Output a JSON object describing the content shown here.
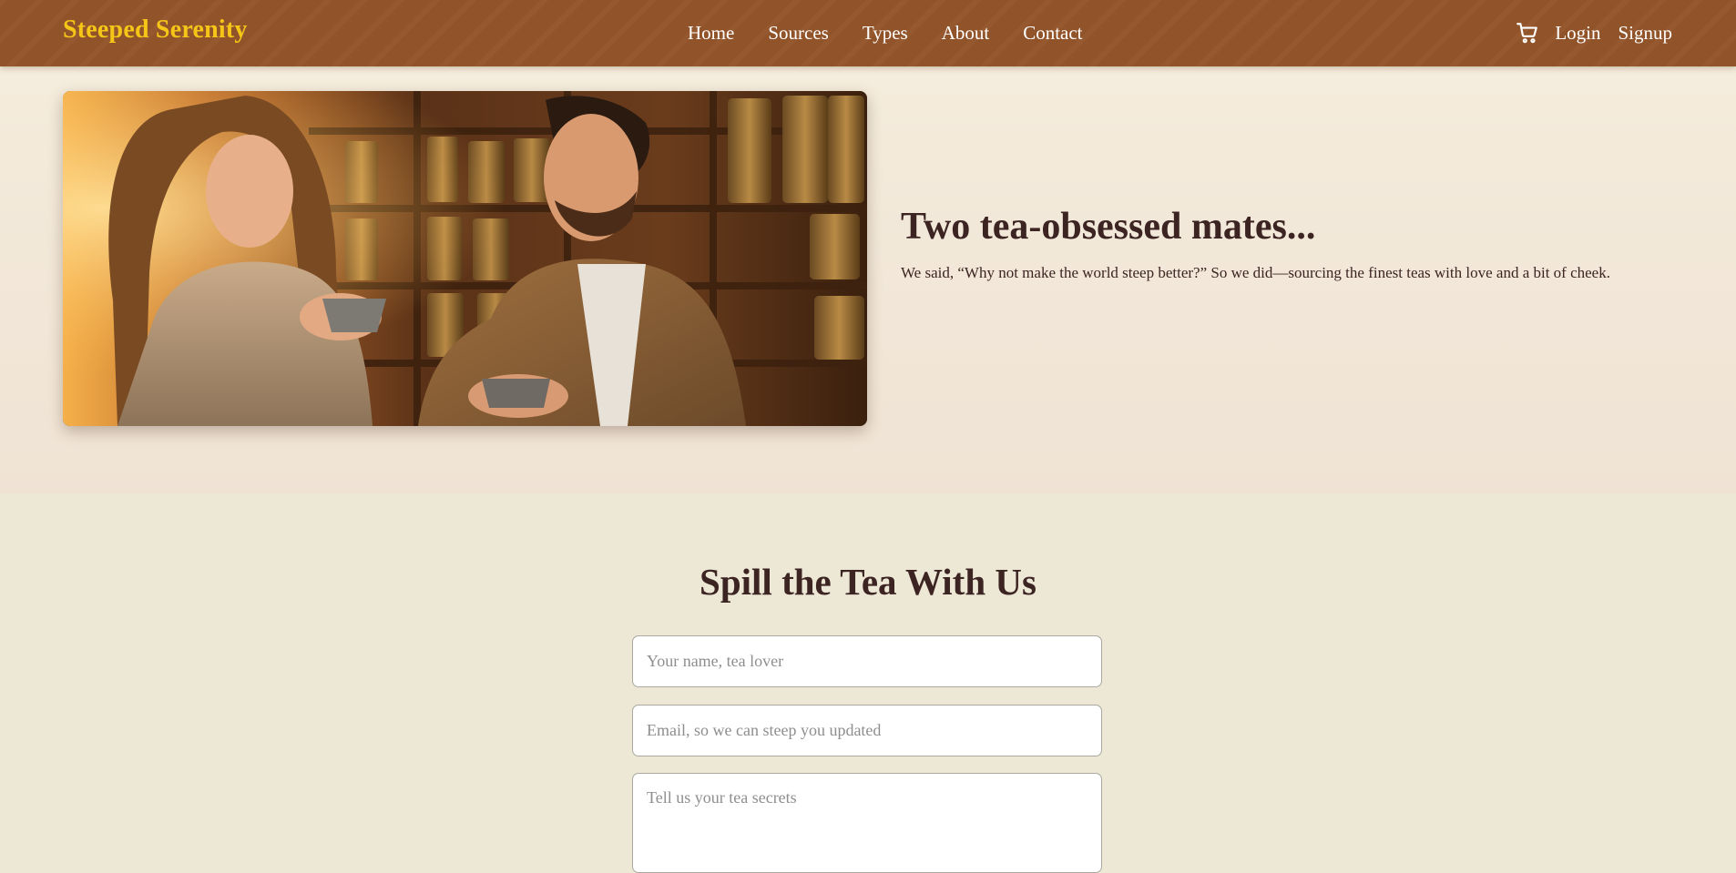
{
  "navbar": {
    "brand": "Steeped Serenity",
    "links": [
      "Home",
      "Sources",
      "Types",
      "About",
      "Contact"
    ],
    "cart_icon": "shopping-cart-icon",
    "login": "Login",
    "signup": "Signup"
  },
  "hero": {
    "image_alt": "Two friends smiling and sharing cups of tea in front of shelves of tea tins",
    "title": "Two tea-obsessed mates...",
    "description": "We said, “Why not make the world steep better?” So we did—sourcing the finest teas with love and a bit of cheek."
  },
  "contact": {
    "title": "Spill the Tea With Us",
    "name_placeholder": "Your name, tea lover",
    "email_placeholder": "Email, so we can steep you updated",
    "message_placeholder": "Tell us your tea secrets"
  },
  "colors": {
    "navbar": "#94552a",
    "brand": "#f5c518",
    "heading": "#3c2422",
    "page_background": "#ede7d6"
  }
}
